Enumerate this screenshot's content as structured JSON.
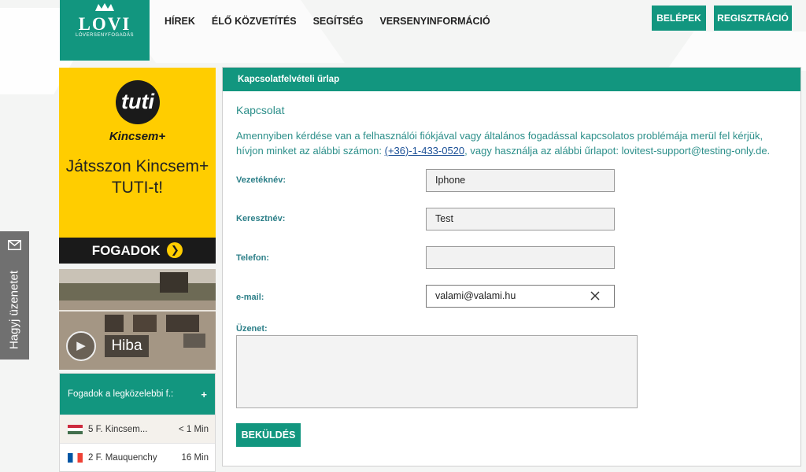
{
  "brand": {
    "name": "LOVI",
    "tagline": "LÓVERSENYFOGADÁS"
  },
  "nav": {
    "items": [
      "HÍREK",
      "ÉLŐ KÖZVETÍTÉS",
      "SEGÍTSÉG",
      "VERSENYINFORMÁCIÓ"
    ]
  },
  "header": {
    "login_label": "BELÉPEK",
    "register_label": "REGISZTRÁCIÓ"
  },
  "promo": {
    "circle_text": "tuti",
    "sub_logo": "Kincsem+",
    "text_line1": "Játsszon Kincsem+",
    "text_line2": "TUTI-t!",
    "cta": "FOGADOK",
    "cta_icon": "chevron-right-icon"
  },
  "video": {
    "status_label": "Hiba",
    "icon": "play-icon"
  },
  "upcoming": {
    "title": "Fogadok a legközelebbi f.:",
    "toggle": "+",
    "races": [
      {
        "flag": "hu",
        "name": "5 F. Kincsem...",
        "time": "< 1 Min"
      },
      {
        "flag": "fr",
        "name": "2 F. Mauquenchy",
        "time": "16 Min"
      }
    ]
  },
  "feedback": {
    "label": "Hagyj üzenetet",
    "icon": "mail-icon"
  },
  "form": {
    "title": "Kapcsolatfelvételi űrlap",
    "subtitle": "Kapcsolat",
    "info_before": "Amennyiben kérdése van a felhasználói fiókjával vagy általános fogadással kapcsolatos problémája merül fel kérjük, hívjon minket az alábbi számon: ",
    "phone": "(+36)-1-433-0520",
    "info_after": ", vagy használja az alábbi űrlapot: lovitest-support@testing-only.de.",
    "fields": {
      "lastname_label": "Vezetéknév:",
      "lastname_value": "Iphone",
      "firstname_label": "Keresztnév:",
      "firstname_value": "Test",
      "phone_label": "Telefon:",
      "phone_value": "",
      "email_label": "e-mail:",
      "email_value": "valami@valami.hu",
      "message_label": "Üzenet:",
      "message_value": ""
    },
    "submit_label": "BEKÜLDÉS"
  },
  "colors": {
    "accent": "#12967f",
    "promo": "#ffcd00",
    "link": "#2c8f8a"
  }
}
